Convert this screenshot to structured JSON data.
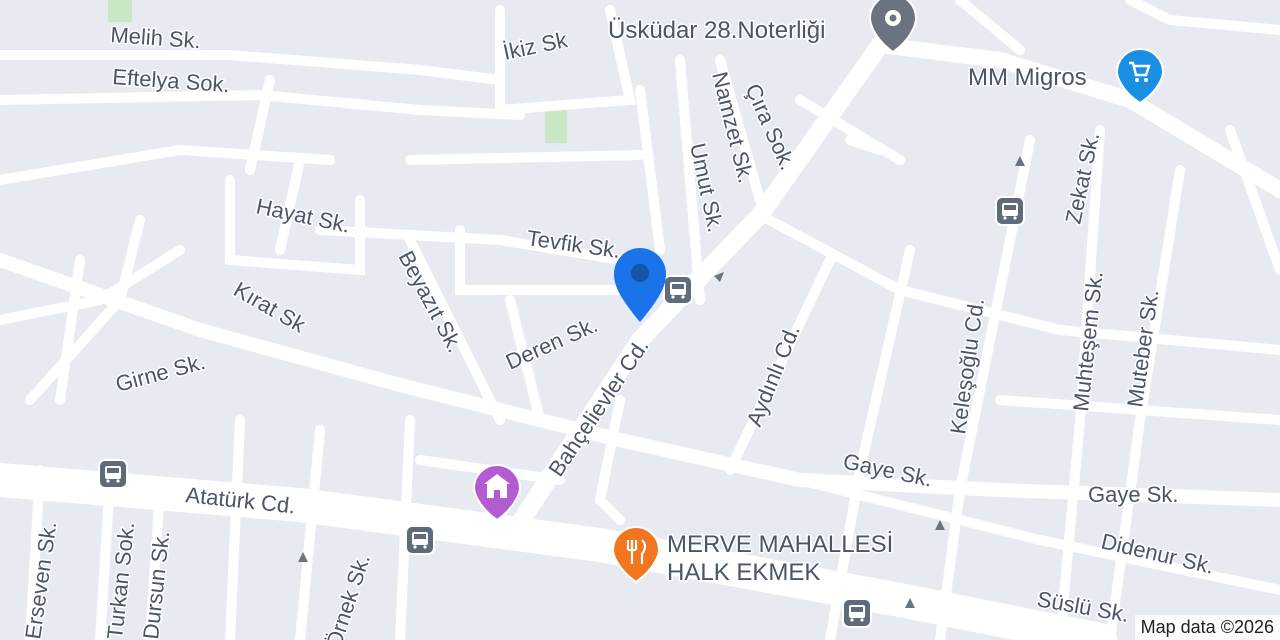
{
  "streets": {
    "melih": "Melih Sk.",
    "eftelya": "Eftelya Sok.",
    "ikiz": "İkiz Sk",
    "hayat": "Hayat Sk.",
    "tevfik": "Tevfik Sk.",
    "beyazit": "Beyazıt Sk.",
    "kirat": "Kırat Sk",
    "deren": "Deren Sk.",
    "girne": "Girne Sk.",
    "umut": "Umut Sk.",
    "namzet": "Namzet Sk.",
    "cira": "Çıra Sok.",
    "bahcelievler": "Bahçelievler Cd.",
    "aydinli": "Aydınlı Cd.",
    "keleşoglu": "Keleşoğlu Cd.",
    "zekat": "Zekat Sk.",
    "muhtesem": "Muhteşem Sk.",
    "muteber": "Muteber Sk.",
    "gaye1": "Gaye Sk.",
    "gaye2": "Gaye Sk.",
    "didenur": "Didenur Sk.",
    "suslu": "Süslü Sk.",
    "ataturk": "Atatürk Cd.",
    "erseven": "Erseven Sk.",
    "turkan": "Turkan Sok.",
    "dursun": "Dursun Sk.",
    "ornek": "Örnek Sk."
  },
  "pois": {
    "noterlik": {
      "label": "Üsküdar 28.Noterliği",
      "icon": "location-pin-icon",
      "color": "#6b7280"
    },
    "migros": {
      "label": "MM Migros",
      "icon": "shopping-cart-icon",
      "color": "#1a8fe3"
    },
    "halk_ekmek_line1": "MERVE MAHALLESİ",
    "halk_ekmek_line2": "HALK EKMEK",
    "halk_ekmek": {
      "icon": "restaurant-icon",
      "color": "#f1761e"
    },
    "landmark": {
      "icon": "government-building-icon",
      "color": "#b35bd1"
    }
  },
  "marker": {
    "icon": "location-marker-icon",
    "color": "#1a73e8"
  },
  "bus_stop_icon": "bus-icon",
  "attribution": "Map data ©2026"
}
